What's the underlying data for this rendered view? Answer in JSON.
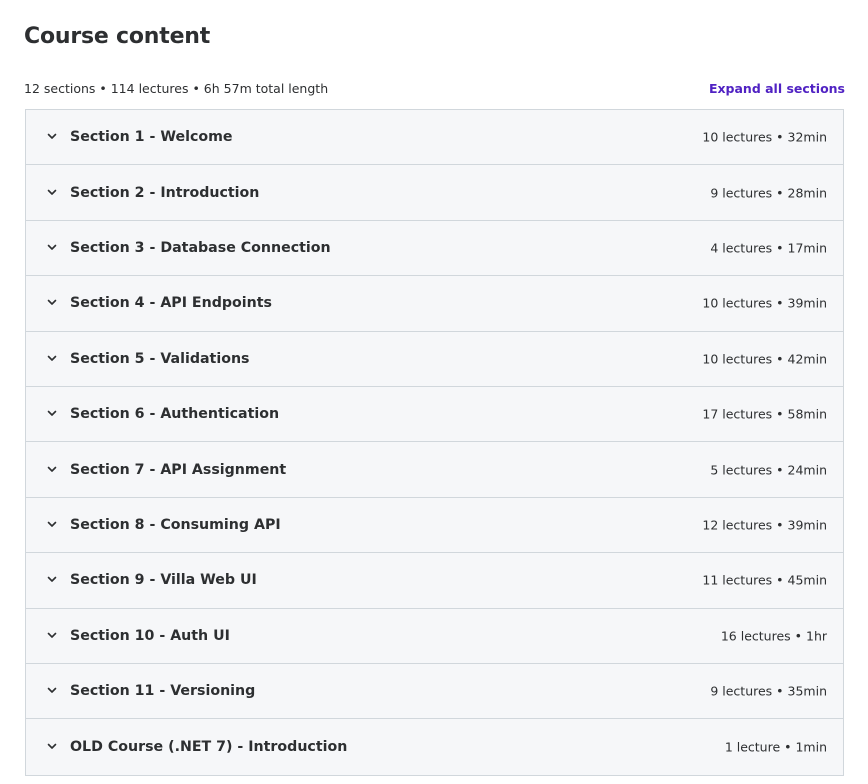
{
  "header": {
    "title": "Course content",
    "summary": "12 sections • 114 lectures • 6h 57m total length",
    "expand_label": "Expand all sections"
  },
  "icons": {
    "chevron": "chevron-down-icon"
  },
  "colors": {
    "accent": "#5022c3",
    "text": "#2d2f31",
    "border": "#d1d7dc",
    "section_bg": "#f6f7f9"
  },
  "sections": [
    {
      "title": "Section 1 - Welcome",
      "meta": "10 lectures • 32min"
    },
    {
      "title": "Section 2 - Introduction",
      "meta": "9 lectures • 28min"
    },
    {
      "title": "Section 3 - Database Connection",
      "meta": "4 lectures • 17min"
    },
    {
      "title": "Section 4 - API Endpoints",
      "meta": "10 lectures • 39min"
    },
    {
      "title": "Section 5 - Validations",
      "meta": "10 lectures • 42min"
    },
    {
      "title": "Section 6 - Authentication",
      "meta": "17 lectures • 58min"
    },
    {
      "title": "Section 7 - API Assignment",
      "meta": "5 lectures • 24min"
    },
    {
      "title": "Section 8 - Consuming API",
      "meta": "12 lectures • 39min"
    },
    {
      "title": "Section 9 - Villa Web UI",
      "meta": "11 lectures • 45min"
    },
    {
      "title": "Section 10 - Auth UI",
      "meta": "16 lectures • 1hr"
    },
    {
      "title": "Section 11 - Versioning",
      "meta": "9 lectures • 35min"
    },
    {
      "title": "OLD Course (.NET 7) - Introduction",
      "meta": "1 lecture • 1min"
    }
  ]
}
